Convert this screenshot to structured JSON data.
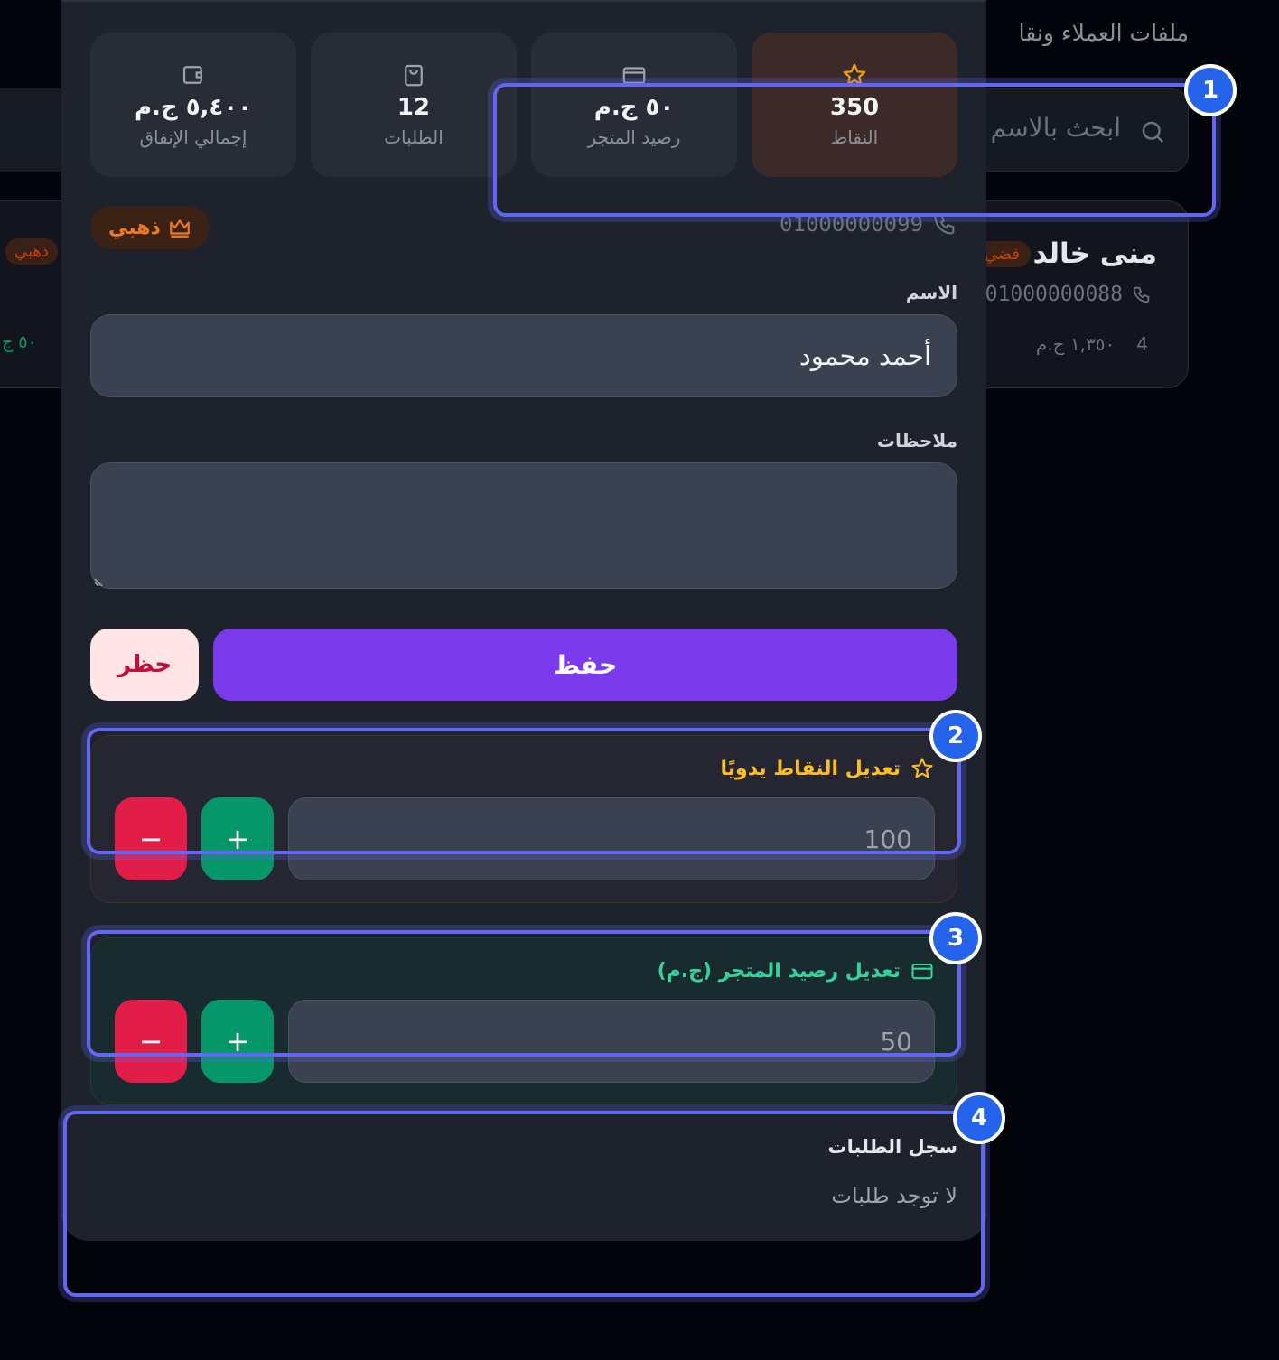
{
  "background": {
    "page_title": "ملفات العملاء ونقا",
    "search_placeholder": "ابحث بالاسم",
    "customer_card": {
      "name": "منى خالد",
      "badge": "فضي",
      "phone": "01000000088",
      "orders_count": "4",
      "spent": "١,٣٥٠ ج.م"
    },
    "left_card": {
      "badge": "ذهبي",
      "money": "٥٠ ج"
    }
  },
  "drawer": {
    "stats": [
      {
        "icon": "star-icon",
        "value": "350",
        "label": "النقاط"
      },
      {
        "icon": "credit-card-icon",
        "value": "٥٠ ج.م",
        "label": "رصيد المتجر"
      },
      {
        "icon": "shopping-bag-icon",
        "value": "12",
        "label": "الطلبات"
      },
      {
        "icon": "wallet-icon",
        "value": "٥,٤٠٠ ج.م",
        "label": "إجمالي الإنفاق"
      }
    ],
    "tier_badge": "ذهبي",
    "phone": "01000000099",
    "name_label": "الاسم",
    "name_value": "أحمد محمود",
    "notes_label": "ملاحظات",
    "notes_value": "",
    "save_label": "حفظ",
    "ban_label": "حظر",
    "points_adjust": {
      "title": "تعديل النقاط يدويًا",
      "value": "100",
      "plus": "+",
      "minus": "−"
    },
    "balance_adjust": {
      "title": "تعديل رصيد المتجر (ج.م)",
      "value": "50",
      "plus": "+",
      "minus": "−"
    },
    "history": {
      "title": "سجل الطلبات",
      "empty": "لا توجد طلبات"
    }
  },
  "annotations": [
    "1",
    "2",
    "3",
    "4"
  ],
  "colors": {
    "accent": "#7c3aed",
    "gold": "#fbbf24",
    "green": "#34d399",
    "danger": "#e11d48",
    "annotation": "#6366f1"
  }
}
